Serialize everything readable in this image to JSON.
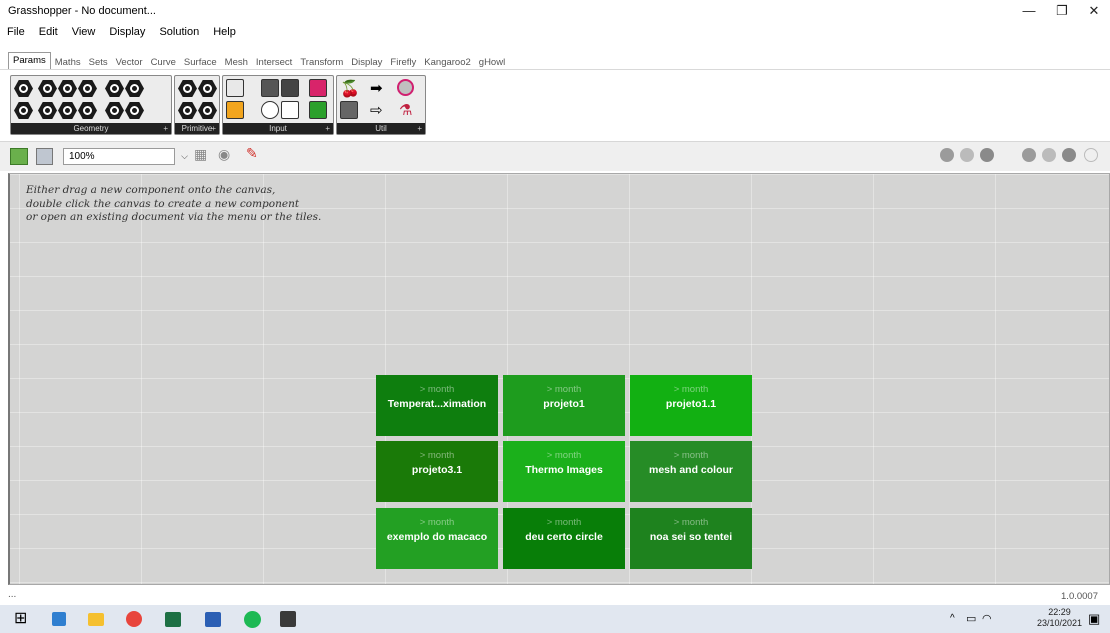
{
  "window": {
    "title": "Grasshopper - No document...",
    "minimize": "—",
    "maximize": "❐",
    "close": "✕"
  },
  "menu": [
    "File",
    "Edit",
    "View",
    "Display",
    "Solution",
    "Help"
  ],
  "tabs": [
    "Params",
    "Maths",
    "Sets",
    "Vector",
    "Curve",
    "Surface",
    "Mesh",
    "Intersect",
    "Transform",
    "Display",
    "Firefly",
    "Kangaroo2",
    "gHowl"
  ],
  "ribbon": {
    "groups": [
      "Geometry",
      "Primitive",
      "Input",
      "Util"
    ]
  },
  "toolbar": {
    "zoom": "100%"
  },
  "canvas": {
    "hint": [
      "Either drag a new component onto the canvas,",
      "double click the canvas to create a new component",
      "or open an existing document via the menu or the tiles."
    ],
    "tiles": [
      {
        "caption": "> month",
        "name": "Temperat...ximation",
        "color": "#0e7e0e"
      },
      {
        "caption": "> month",
        "name": "projeto1",
        "color": "#1e9c1e"
      },
      {
        "caption": "> month",
        "name": "projeto1.1",
        "color": "#12b012"
      },
      {
        "caption": "> month",
        "name": "projeto3.1",
        "color": "#1a7a08"
      },
      {
        "caption": "> month",
        "name": "Thermo Images",
        "color": "#1bb01b"
      },
      {
        "caption": "> month",
        "name": "mesh and colour",
        "color": "#268c26"
      },
      {
        "caption": "> month",
        "name": "exemplo do macaco",
        "color": "#23a023"
      },
      {
        "caption": "> month",
        "name": "deu certo circle",
        "color": "#087e08"
      },
      {
        "caption": "> month",
        "name": "noa sei so tentei",
        "color": "#1e821e"
      }
    ]
  },
  "status": {
    "left": "...",
    "version": "1.0.0007"
  },
  "taskbar": {
    "time": "22:29",
    "date": "23/10/2021",
    "tray": "^"
  }
}
